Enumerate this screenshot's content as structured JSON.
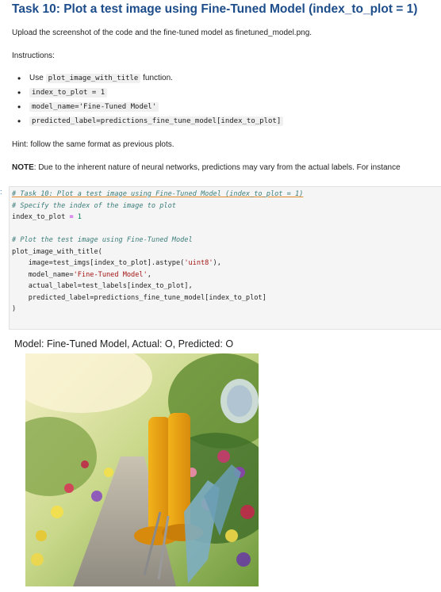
{
  "markdown": {
    "title": "Task 10: Plot a test image using Fine-Tuned Model (index_to_plot = 1)",
    "upload_text": "Upload the screenshot of the code and the fine-tuned model as finetuned_model.png.",
    "instructions_label": "Instructions:",
    "bullets": [
      {
        "prefix": "Use ",
        "code": "plot_image_with_title",
        "suffix": " function."
      },
      {
        "prefix": "",
        "code": "index_to_plot = 1",
        "suffix": ""
      },
      {
        "prefix": "",
        "code": "model_name='Fine-Tuned Model'",
        "suffix": ""
      },
      {
        "prefix": "",
        "code": "predicted_label=predictions_fine_tune_model[index_to_plot]",
        "suffix": ""
      }
    ],
    "hint": "Hint: follow the same format as previous plots.",
    "note_label": "NOTE",
    "note_text": ": Due to the inherent nature of neural networks, predictions may vary from the actual labels. For instance"
  },
  "code_cell": {
    "marker": ":",
    "lines": {
      "l1": "# Task 10: Plot a test image using Fine-Tuned Model (index_to_plot = 1)",
      "l2": "# Specify the index of the image to plot",
      "l3_a": "index_to_plot ",
      "l3_op": "=",
      "l3_num": " 1",
      "l5": "# Plot the test image using Fine-Tuned Model",
      "l6": "plot_image_with_title(",
      "l7_a": "    image=test_imgs[index_to_plot].astype(",
      "l7_str": "'uint8'",
      "l7_b": "),",
      "l8_a": "    model_name=",
      "l8_str": "'Fine-Tuned Model'",
      "l8_b": ",",
      "l9": "    actual_label=test_labels[index_to_plot],",
      "l10": "    predicted_label=predictions_fine_tune_model[index_to_plot]",
      "l11": ")"
    }
  },
  "output": {
    "plot_title": "Model: Fine-Tuned Model, Actual: O, Predicted: O",
    "image_subject": "garden-boots-and-flowers"
  }
}
